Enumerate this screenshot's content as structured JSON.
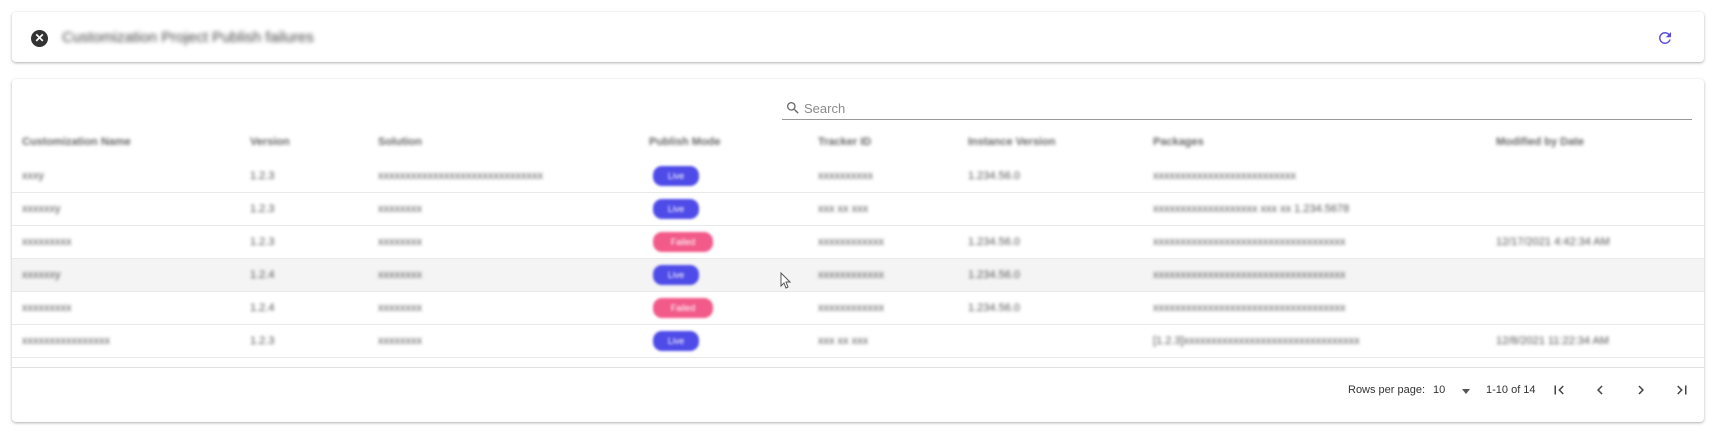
{
  "header": {
    "title": "Customization Project Publish failures",
    "close_icon": "close-circle-icon",
    "refresh_icon": "refresh-icon"
  },
  "search": {
    "placeholder": "Search",
    "icon": "search-icon"
  },
  "table": {
    "columns": [
      "Customization Name",
      "Version",
      "Solution",
      "Publish Mode",
      "Tracker ID",
      "Instance Version",
      "Packages",
      "Modified by Date"
    ],
    "rows": [
      {
        "name": "xxxy",
        "version": "1.2.3",
        "solution": "xxxxxxxxxxxxxxxxxxxxxxxxxxxxxx",
        "mode": "Live",
        "mode_color": "#4f4be8",
        "tracker": "xxxxxxxxxx",
        "instance": "1.234.56.0",
        "packages": "xxxxxxxxxxxxxxxxxxxxxxxxxx",
        "modified": ""
      },
      {
        "name": "xxxxxxy",
        "version": "1.2.3",
        "solution": "xxxxxxxx",
        "mode": "Live",
        "mode_color": "#4f4be8",
        "tracker": "xxx xx xxx",
        "instance": "",
        "packages": "xxxxxxxxxxxxxxxxxxx xxx xx 1.234.5678",
        "modified": ""
      },
      {
        "name": "xxxxxxxxx",
        "version": "1.2.3",
        "solution": "xxxxxxxx",
        "mode": "Failed",
        "mode_color": "#f25a8a",
        "tracker": "xxxxxxxxxxxx",
        "instance": "1.234.56.0",
        "packages": "xxxxxxxxxxxxxxxxxxxxxxxxxxxxxxxxxxx",
        "modified": "12/17/2021 4:42:34 AM"
      },
      {
        "name": "xxxxxxy",
        "version": "1.2.4",
        "solution": "xxxxxxxx",
        "mode": "Live",
        "mode_color": "#4f4be8",
        "tracker": "xxxxxxxxxxxx",
        "instance": "1.234.56.0",
        "packages": "xxxxxxxxxxxxxxxxxxxxxxxxxxxxxxxxxxx",
        "modified": ""
      },
      {
        "name": "xxxxxxxxx",
        "version": "1.2.4",
        "solution": "xxxxxxxx",
        "mode": "Failed",
        "mode_color": "#f25a8a",
        "tracker": "xxxxxxxxxxxx",
        "instance": "1.234.56.0",
        "packages": "xxxxxxxxxxxxxxxxxxxxxxxxxxxxxxxxxxx",
        "modified": ""
      },
      {
        "name": "xxxxxxxxxxxxxxxx",
        "version": "1.2.3",
        "solution": "xxxxxxxx",
        "mode": "Live",
        "mode_color": "#4f4be8",
        "tracker": "xxx xx xxx",
        "instance": "",
        "packages": "[1.2.3]xxxxxxxxxxxxxxxxxxxxxxxxxxxxxxxx",
        "modified": "12/8/2021 11:22:34 AM"
      }
    ],
    "hovered_row_index": 3
  },
  "pagination": {
    "rows_per_page_label": "Rows per page:",
    "rows_per_page_value": "10",
    "range_text": "1-10 of 14",
    "first_icon": "first-page-icon",
    "prev_icon": "chevron-left-icon",
    "next_icon": "chevron-right-icon",
    "last_icon": "last-page-icon"
  },
  "colors": {
    "accent": "#5b4fd9",
    "live_chip": "#4f4be8",
    "failed_chip": "#f25a8a"
  }
}
